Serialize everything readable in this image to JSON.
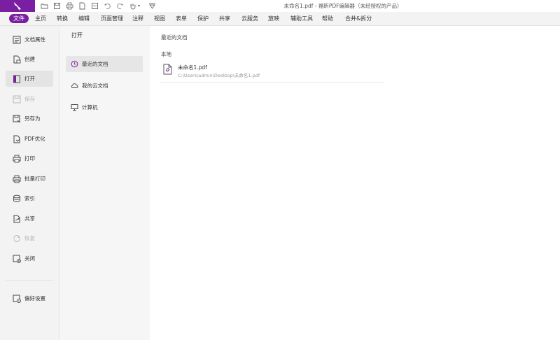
{
  "window": {
    "title": "未命名1.pdf - 福昕PDF编辑器（未经授权的产品）"
  },
  "menubar": {
    "items": [
      "文件",
      "主页",
      "转换",
      "编辑",
      "页面管理",
      "注释",
      "视图",
      "表单",
      "保护",
      "共享",
      "云服务",
      "放映",
      "辅助工具",
      "帮助",
      "合并&拆分"
    ]
  },
  "leftnav": {
    "items": [
      {
        "label": "文档属性",
        "icon": "document-properties-icon"
      },
      {
        "label": "创建",
        "icon": "create-icon"
      },
      {
        "label": "打开",
        "icon": "open-icon"
      },
      {
        "label": "保存",
        "icon": "save-icon"
      },
      {
        "label": "另存为",
        "icon": "save-as-icon"
      },
      {
        "label": "PDF优化",
        "icon": "optimize-icon"
      },
      {
        "label": "打印",
        "icon": "print-icon"
      },
      {
        "label": "批量打印",
        "icon": "batch-print-icon"
      },
      {
        "label": "索引",
        "icon": "index-icon"
      },
      {
        "label": "共享",
        "icon": "share-icon"
      },
      {
        "label": "恢复",
        "icon": "restore-icon"
      },
      {
        "label": "关闭",
        "icon": "close-icon"
      },
      {
        "label": "偏好设置",
        "icon": "preferences-icon"
      }
    ]
  },
  "open_panel": {
    "title": "打开",
    "items": [
      {
        "label": "最近的文档",
        "icon": "clock-icon"
      },
      {
        "label": "我的云文档",
        "icon": "cloud-icon"
      },
      {
        "label": "计算机",
        "icon": "computer-icon"
      }
    ]
  },
  "main": {
    "title": "最近的文档",
    "section_label": "本地",
    "files": [
      {
        "name": "未命名1.pdf",
        "path": "C:\\Users\\admin\\Desktop\\未命名1.pdf"
      }
    ]
  },
  "colors": {
    "accent": "#7b1fa2"
  }
}
